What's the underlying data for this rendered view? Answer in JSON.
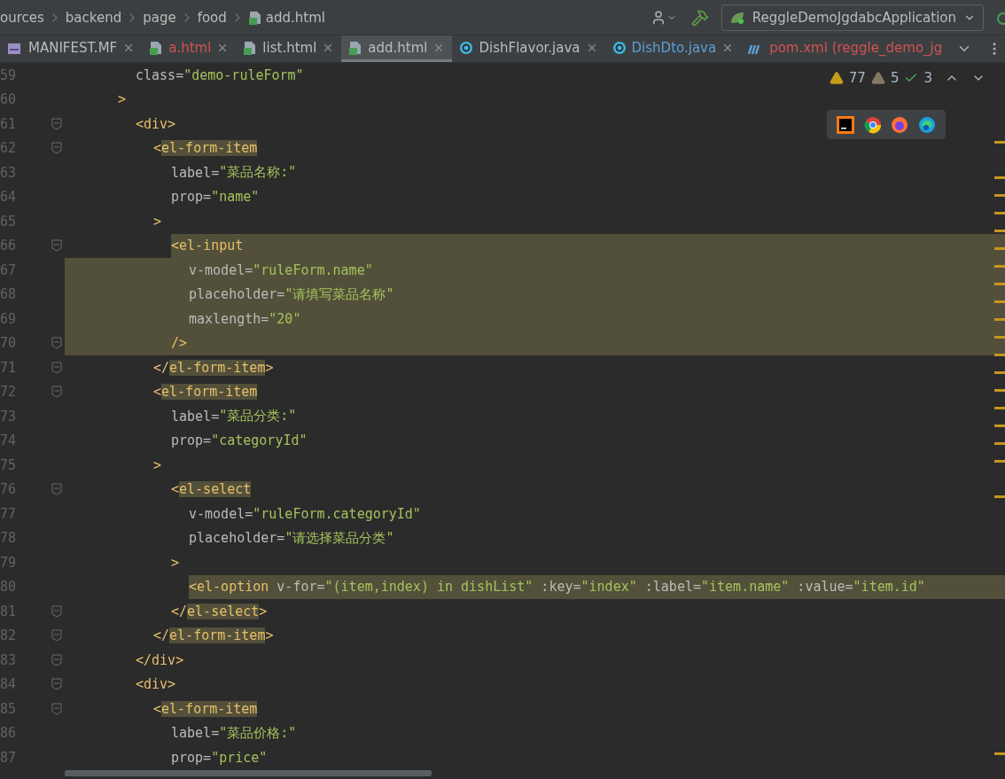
{
  "breadcrumb": {
    "items": [
      "ources",
      "backend",
      "page",
      "food"
    ],
    "file": "add.html"
  },
  "toolbar": {
    "run_config": "ReggleDemoJgdabcApplication"
  },
  "tabs": [
    {
      "label": "MANIFEST.MF",
      "kind": "mf",
      "color": "#bbbbbb",
      "selected": false
    },
    {
      "label": "a.html",
      "kind": "html",
      "color": "#d25252",
      "selected": false
    },
    {
      "label": "list.html",
      "kind": "html",
      "color": "#bbbbbb",
      "selected": false
    },
    {
      "label": "add.html",
      "kind": "html",
      "color": "#bbbbbb",
      "selected": true
    },
    {
      "label": "DishFlavor.java",
      "kind": "class",
      "color": "#bbbbbb",
      "selected": false
    },
    {
      "label": "DishDto.java",
      "kind": "class",
      "color": "#5c9fd6",
      "selected": false
    },
    {
      "label": "pom.xml (reggle_demo_jg",
      "kind": "maven",
      "color": "#d25252",
      "selected": false
    }
  ],
  "inspections": {
    "warnings": "77",
    "weak_warnings": "5",
    "typos": "3"
  },
  "lines": [
    {
      "children": [
        {
          "num": "59",
          "tokens": [
            {
              "kind": "attr",
              "t": "class="
            },
            {
              "kind": "str",
              "t": "\"demo-ruleForm\""
            }
          ]
        }
      ]
    },
    {
      "num": "60",
      "tokens": [
        {
          "kind": "tag",
          "t": ">"
        }
      ],
      "children": [
        {
          "num": "61",
          "fold": true,
          "tokens": [
            {
              "kind": "tag",
              "t": "<div>"
            }
          ],
          "children": [
            {
              "num": "62",
              "fold": true,
              "tokens": [
                {
                  "kind": "tag",
                  "t": "<"
                },
                {
                  "kind": "tag",
                  "t": "el-form-item",
                  "marked": true
                }
              ],
              "children": [
                {
                  "num": "63",
                  "tokens": [
                    {
                      "kind": "attr",
                      "t": "label="
                    },
                    {
                      "kind": "str",
                      "t": "\"菜品名称:\""
                    }
                  ]
                },
                {
                  "num": "64",
                  "tokens": [
                    {
                      "kind": "attr",
                      "t": "prop="
                    },
                    {
                      "kind": "str",
                      "t": "\"name\""
                    }
                  ]
                }
              ]
            },
            {
              "num": "65",
              "tokens": [
                {
                  "kind": "tag",
                  "t": ">"
                }
              ],
              "children": [
                {
                  "num": "66",
                  "fold": true,
                  "highlighted": true,
                  "tokens": [
                    {
                      "kind": "tag",
                      "t": "<"
                    },
                    {
                      "kind": "tag",
                      "t": "el-input"
                    }
                  ],
                  "children": [
                    {
                      "num": "67",
                      "highlighted": true,
                      "highlight_indent": true,
                      "tokens": [
                        {
                          "kind": "attr",
                          "t": "v-model="
                        },
                        {
                          "kind": "str",
                          "t": "\"ruleForm.name\""
                        }
                      ]
                    },
                    {
                      "num": "68",
                      "highlighted": true,
                      "highlight_indent": true,
                      "tokens": [
                        {
                          "kind": "attr",
                          "t": "placeholder="
                        },
                        {
                          "kind": "str",
                          "t": "\"请填写菜品名称\""
                        }
                      ]
                    },
                    {
                      "num": "69",
                      "highlighted": true,
                      "highlight_indent": true,
                      "tokens": [
                        {
                          "kind": "attr",
                          "t": "maxlength="
                        },
                        {
                          "kind": "str",
                          "t": "\"20\""
                        }
                      ]
                    }
                  ]
                },
                {
                  "num": "70",
                  "fold": true,
                  "highlighted": true,
                  "highlight_indent": true,
                  "tokens": [
                    {
                      "kind": "tag",
                      "t": "/>"
                    }
                  ]
                }
              ]
            },
            {
              "num": "71",
              "fold": true,
              "tokens": [
                {
                  "kind": "tag",
                  "t": "</"
                },
                {
                  "kind": "tag",
                  "t": "el-form-item",
                  "marked": true
                },
                {
                  "kind": "tag",
                  "t": ">"
                }
              ]
            },
            {
              "num": "72",
              "fold": true,
              "tokens": [
                {
                  "kind": "tag",
                  "t": "<"
                },
                {
                  "kind": "tag",
                  "t": "el-form-item",
                  "marked": true
                }
              ],
              "children": [
                {
                  "num": "73",
                  "tokens": [
                    {
                      "kind": "attr",
                      "t": "label="
                    },
                    {
                      "kind": "str",
                      "t": "\"菜品分类:\""
                    }
                  ]
                },
                {
                  "num": "74",
                  "tokens": [
                    {
                      "kind": "attr",
                      "t": "prop="
                    },
                    {
                      "kind": "str",
                      "t": "\"categoryId\""
                    }
                  ]
                }
              ]
            },
            {
              "num": "75",
              "tokens": [
                {
                  "kind": "tag",
                  "t": ">"
                }
              ],
              "children": [
                {
                  "num": "76",
                  "fold": true,
                  "tokens": [
                    {
                      "kind": "tag",
                      "t": "<"
                    },
                    {
                      "kind": "tag",
                      "t": "el-select",
                      "marked": true
                    }
                  ],
                  "children": [
                    {
                      "num": "77",
                      "tokens": [
                        {
                          "kind": "attr",
                          "t": "v-model="
                        },
                        {
                          "kind": "str",
                          "t": "\"ruleForm.categoryId\""
                        }
                      ]
                    },
                    {
                      "num": "78",
                      "tokens": [
                        {
                          "kind": "attr",
                          "t": "placeholder="
                        },
                        {
                          "kind": "str",
                          "t": "\"请选择菜品分类\""
                        }
                      ]
                    }
                  ]
                },
                {
                  "num": "79",
                  "tokens": [
                    {
                      "kind": "tag",
                      "t": ">"
                    }
                  ],
                  "children": [
                    {
                      "num": "80",
                      "highlighted": true,
                      "tokens": [
                        {
                          "kind": "tag",
                          "t": "<"
                        },
                        {
                          "kind": "tag",
                          "t": "el-option"
                        },
                        {
                          "kind": "attr",
                          "t": " v-for="
                        },
                        {
                          "kind": "str",
                          "t": "\"(item,index) in dishList\""
                        },
                        {
                          "kind": "attr",
                          "t": " :key="
                        },
                        {
                          "kind": "str",
                          "t": "\"index\""
                        },
                        {
                          "kind": "attr",
                          "t": " :label="
                        },
                        {
                          "kind": "str",
                          "t": "\"item.name\""
                        },
                        {
                          "kind": "attr",
                          "t": " :value="
                        },
                        {
                          "kind": "str",
                          "t": "\"item.id\""
                        }
                      ]
                    }
                  ]
                },
                {
                  "num": "81",
                  "fold": true,
                  "tokens": [
                    {
                      "kind": "tag",
                      "t": "</"
                    },
                    {
                      "kind": "tag",
                      "t": "el-select",
                      "marked": true
                    },
                    {
                      "kind": "tag",
                      "t": ">"
                    }
                  ]
                }
              ]
            },
            {
              "num": "82",
              "fold": true,
              "tokens": [
                {
                  "kind": "tag",
                  "t": "</"
                },
                {
                  "kind": "tag",
                  "t": "el-form-item",
                  "marked": true
                },
                {
                  "kind": "tag",
                  "t": ">"
                }
              ]
            }
          ]
        },
        {
          "num": "83",
          "fold": true,
          "tokens": [
            {
              "kind": "tag",
              "t": "</div>"
            }
          ]
        },
        {
          "num": "84",
          "fold": true,
          "tokens": [
            {
              "kind": "tag",
              "t": "<div>"
            }
          ],
          "children": [
            {
              "num": "85",
              "fold": true,
              "tokens": [
                {
                  "kind": "tag",
                  "t": "<"
                },
                {
                  "kind": "tag",
                  "t": "el-form-item",
                  "marked": true
                }
              ],
              "children": [
                {
                  "num": "86",
                  "tokens": [
                    {
                      "kind": "attr",
                      "t": "label="
                    },
                    {
                      "kind": "str",
                      "t": "\"菜品价格:\""
                    }
                  ]
                },
                {
                  "num": "87",
                  "tokens": [
                    {
                      "kind": "attr",
                      "t": "prop="
                    },
                    {
                      "kind": "str",
                      "t": "\"price\""
                    }
                  ]
                }
              ]
            }
          ]
        }
      ]
    }
  ]
}
